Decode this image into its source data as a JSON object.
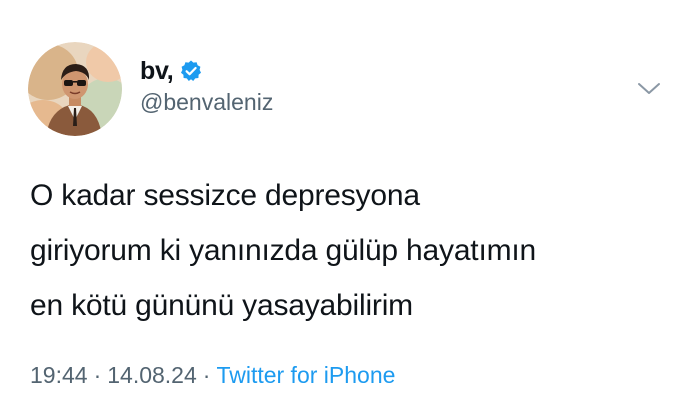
{
  "tweet": {
    "display_name": "bv,",
    "handle": "@benvaleniz",
    "verified": true,
    "text_lines": [
      "O kadar sessizce depresyona",
      "giriyorum ki yanınızda gülüp hayatımın",
      "en kötü gününü yasayabilirim"
    ],
    "time": "19:44",
    "separator": "·",
    "date": "14.08.24",
    "source": "Twitter for iPhone"
  },
  "icons": {
    "verified": "verified-badge-icon",
    "more": "chevron-down-icon"
  },
  "colors": {
    "verified_blue": "#1d9bf0",
    "link_blue": "#1d9bf0",
    "secondary_text": "#536471",
    "primary_text": "#0f1419",
    "chevron": "#8b98a5"
  }
}
